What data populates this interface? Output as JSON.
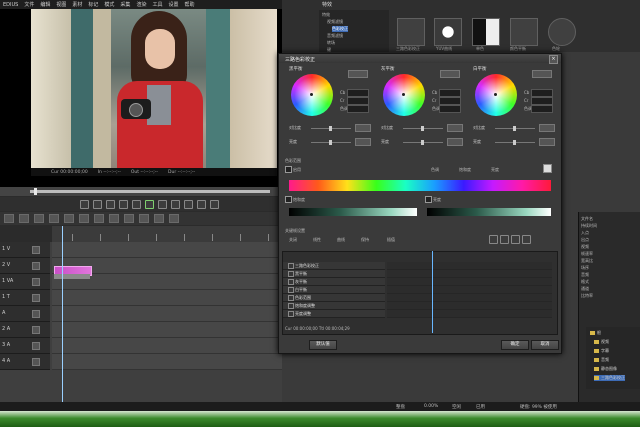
{
  "app": {
    "menu": [
      "EDIUS",
      "文件",
      "编辑",
      "视图",
      "素材",
      "标记",
      "模式",
      "采集",
      "渲染",
      "工具",
      "设置",
      "帮助"
    ],
    "timecodes": [
      "Cur 00:00:00;00",
      "In --:--:--;--",
      "Out --:--:--;--",
      "Dur --:--:--;--"
    ],
    "track_names": [
      "1 V",
      "2 V",
      "1 VA",
      "1 T",
      "A",
      "2 A",
      "3 A",
      "4 A"
    ],
    "status_items": [
      "整盘",
      "0.00%",
      "空闲",
      "已用",
      "硬盘: 99% 被使用"
    ]
  },
  "fx_panel": {
    "title": "特效",
    "tree_items": [
      "特效",
      "视频滤镜",
      "色彩校正",
      "音频滤镜",
      "转场",
      "键"
    ],
    "effects": [
      "三路色彩校正",
      "YUV曲线",
      "单色",
      "颜色平衡",
      "色轮"
    ]
  },
  "dialog": {
    "title": "三路色彩校正",
    "wheels": [
      {
        "title": "黑平衡",
        "button": "重置"
      },
      {
        "title": "灰平衡",
        "button": "重置"
      },
      {
        "title": "白平衡",
        "button": "重置"
      }
    ],
    "wheel_fields": [
      "Cb",
      "Cr",
      "色调"
    ],
    "slider_labels": [
      "对比度",
      "亮度"
    ],
    "reset_label": "重置",
    "section_color_range": "色彩范围",
    "chk_enable": "启用",
    "range_labels": [
      "色调",
      "饱和度",
      "亮度"
    ],
    "lower_checks": [
      "饱和度",
      "亮度"
    ],
    "keyframe_section": "关键帧设置",
    "keyframe_radios": [
      "关闭",
      "线性",
      "曲线",
      "保持",
      "插值"
    ],
    "keyframe_tracks": [
      "三路色彩校正",
      "黑平衡",
      "灰平衡",
      "白平衡",
      "色彩范围",
      "饱和度调整",
      "亮度调整"
    ],
    "kf_timecode": "Cur 00:00:00;00  Ttl 00:00:04;29",
    "bottom_left_button": "默认值",
    "ok_button": "确定",
    "cancel_button": "取消"
  },
  "prop_panel": {
    "rows": [
      "文件名",
      "持续时间",
      "入点",
      "出点",
      "视频",
      "帧速率",
      "宽高比",
      "场序",
      "音频",
      "格式",
      "通道",
      "比特率"
    ],
    "tree": [
      "根",
      "视频",
      "字幕",
      "音频",
      "静态图像",
      "三路色彩校正"
    ]
  },
  "colors": {
    "clip": "#d35ad0",
    "playhead": "#9ad0ff"
  }
}
